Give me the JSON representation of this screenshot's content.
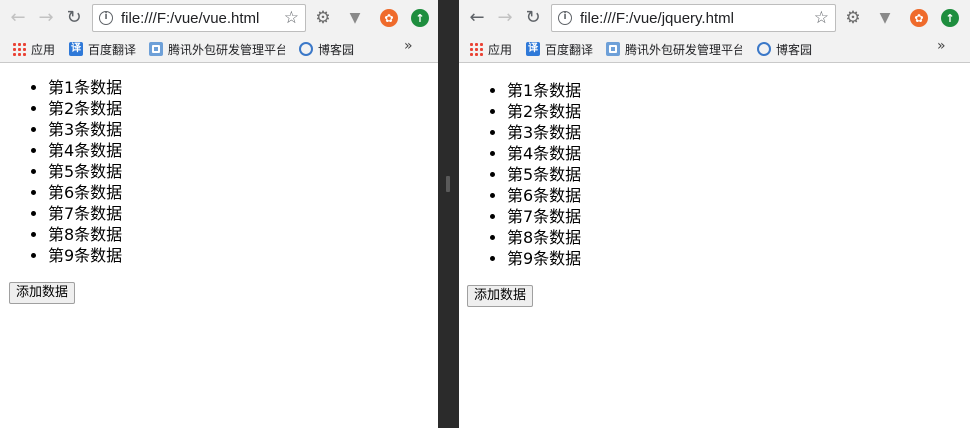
{
  "windows": [
    {
      "url": "file:///F:/vue/vue.html",
      "bookmarks": [
        "应用",
        "百度翻译",
        "腾讯外包研发管理平台",
        "博客园"
      ],
      "more_label": "»",
      "items": [
        "第1条数据",
        "第2条数据",
        "第3条数据",
        "第4条数据",
        "第5条数据",
        "第6条数据",
        "第7条数据",
        "第8条数据",
        "第9条数据"
      ],
      "button_label": "添加数据"
    },
    {
      "url": "file:///F:/vue/jquery.html",
      "bookmarks": [
        "应用",
        "百度翻译",
        "腾讯外包研发管理平台",
        "博客园"
      ],
      "more_label": "»",
      "items": [
        "第1条数据",
        "第2条数据",
        "第3条数据",
        "第4条数据",
        "第5条数据",
        "第6条数据",
        "第7条数据",
        "第8条数据",
        "第9条数据"
      ],
      "button_label": "添加数据"
    }
  ],
  "icons": {
    "back": "arrow-left-icon",
    "forward": "arrow-right-icon",
    "reload": "reload-icon",
    "info": "info-icon",
    "bookmark_star": "star-icon",
    "ext1": "gear-icon",
    "ext2": "vee-icon",
    "ext3": "orange-circle-icon",
    "ext4": "green-up-arrow-icon"
  },
  "colors": {
    "ext_orange": "#ef6b2c",
    "ext_green": "#1e8e3e",
    "translate_blue": "#2f79d8"
  }
}
